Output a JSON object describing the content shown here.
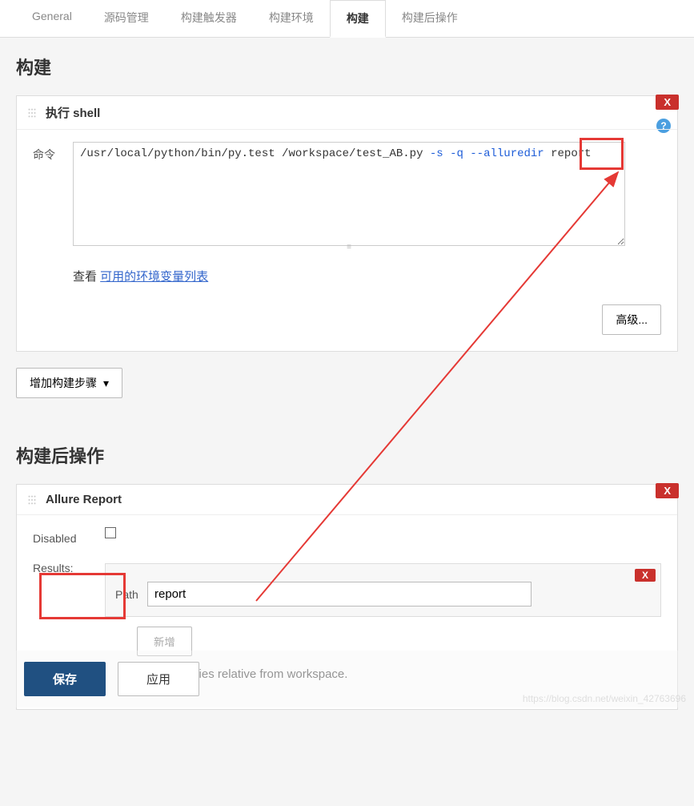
{
  "tabs": {
    "general": "General",
    "scm": "源码管理",
    "triggers": "构建触发器",
    "env": "构建环境",
    "build": "构建",
    "postbuild": "构建后操作"
  },
  "build_section": {
    "title": "构建",
    "shell_step": {
      "title": "执行 shell",
      "close": "X",
      "command_label": "命令",
      "command_plain1": "/usr/local/python/bin/py.test /workspace/test_AB.py ",
      "command_opts": "-s -q --alluredir ",
      "command_plain2": "report",
      "see_label": "查看 ",
      "see_link": "可用的环境变量列表",
      "advanced_btn": "高级...",
      "help_icon": "?"
    },
    "add_step_btn": "增加构建步骤"
  },
  "postbuild_section": {
    "title": "构建后操作",
    "allure_step": {
      "title": "Allure Report",
      "close": "X",
      "disabled_label": "Disabled",
      "results_label": "Results:",
      "path_label": "Path",
      "path_value": "report",
      "results_close": "X",
      "add_new": "新增",
      "help_text": "ults directories relative from workspace."
    }
  },
  "footer": {
    "save": "保存",
    "apply": "应用"
  },
  "watermark": "https://blog.csdn.net/weixin_42763696"
}
